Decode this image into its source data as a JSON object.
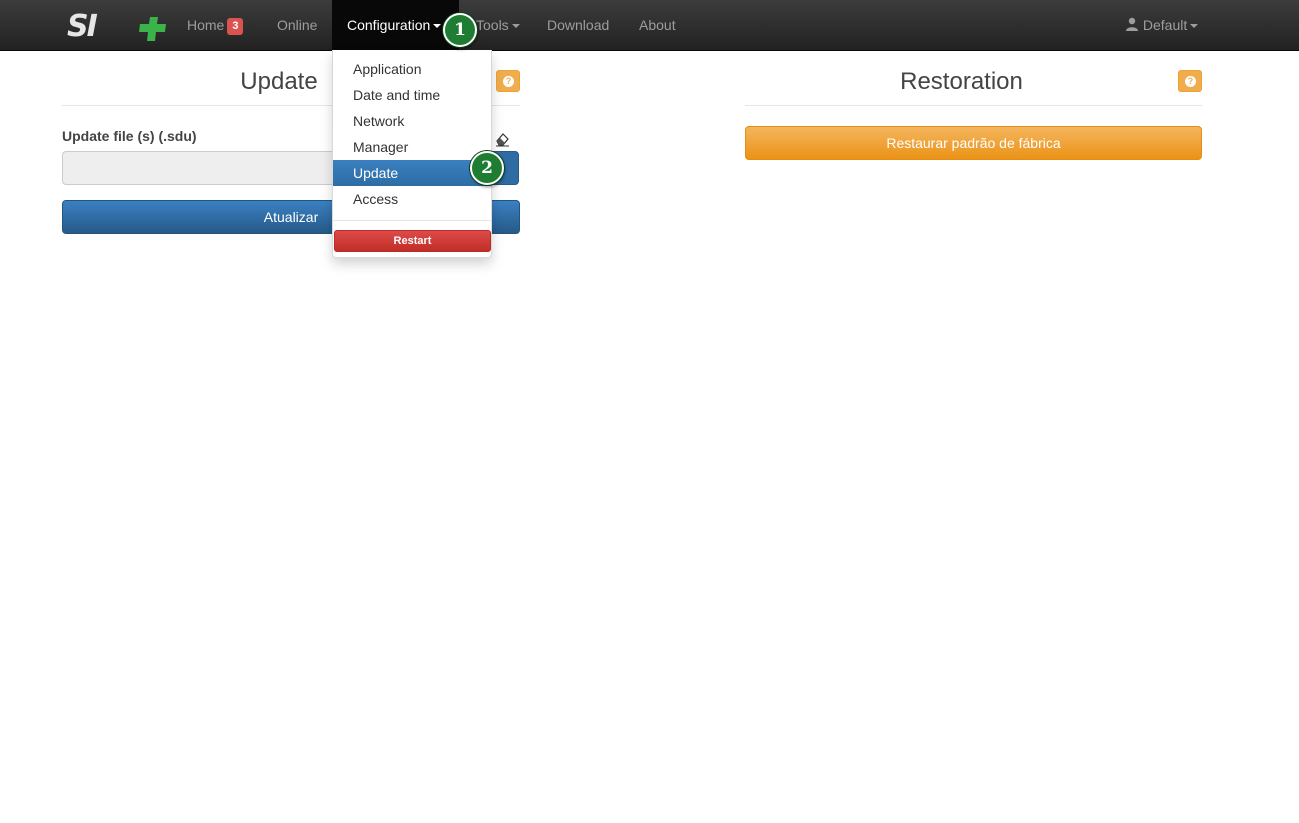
{
  "navbar": {
    "brand": "SI+",
    "home_label": "Home",
    "home_badge": "3",
    "online_label": "Online",
    "configuration_label": "Configuration",
    "tools_label": "Tools",
    "download_label": "Download",
    "about_label": "About",
    "user_label": "Default"
  },
  "configuration_menu": {
    "items": [
      "Application",
      "Date and time",
      "Network",
      "Manager",
      "Update",
      "Access"
    ],
    "selected": "Update",
    "restart_label": "Restart"
  },
  "steps": [
    "1",
    "2"
  ],
  "update_panel": {
    "title": "Update",
    "file_label": "Update file (s) (.sdu)",
    "submit_label": "Atualizar"
  },
  "restoration_panel": {
    "title": "Restoration",
    "reset_label": "Restaurar padrão de fábrica"
  },
  "colors": {
    "navbar": "#222222",
    "primary": "#2e6da4",
    "warning": "#f0ad4e",
    "danger": "#d9534f",
    "step_marker": "#1e7d32"
  }
}
